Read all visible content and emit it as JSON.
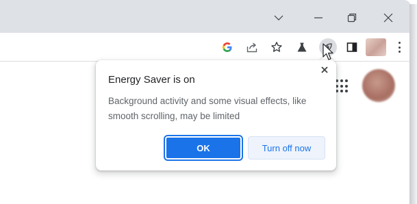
{
  "window": {
    "controls": [
      {
        "name": "tab-search-chevron-icon"
      },
      {
        "name": "minimize-icon"
      },
      {
        "name": "restore-icon"
      },
      {
        "name": "close-icon"
      }
    ]
  },
  "toolbar": {
    "google_logo": "G",
    "icons": [
      "google-lens-icon",
      "share-icon",
      "bookmark-star-icon",
      "labs-flask-icon",
      "energy-saver-leaf-icon",
      "side-panel-icon",
      "profile-avatar",
      "menu-dots-icon"
    ]
  },
  "popup": {
    "title": "Energy Saver is on",
    "body": "Background activity and some visual effects, like smooth scrolling, may be limited",
    "ok_label": "OK",
    "turn_off_label": "Turn off now"
  },
  "colors": {
    "titlebar": "#dee1e6",
    "accent": "#1a73e8",
    "secondary_button_bg": "#eef3fc",
    "text_primary": "#202124",
    "text_secondary": "#5f6368"
  }
}
